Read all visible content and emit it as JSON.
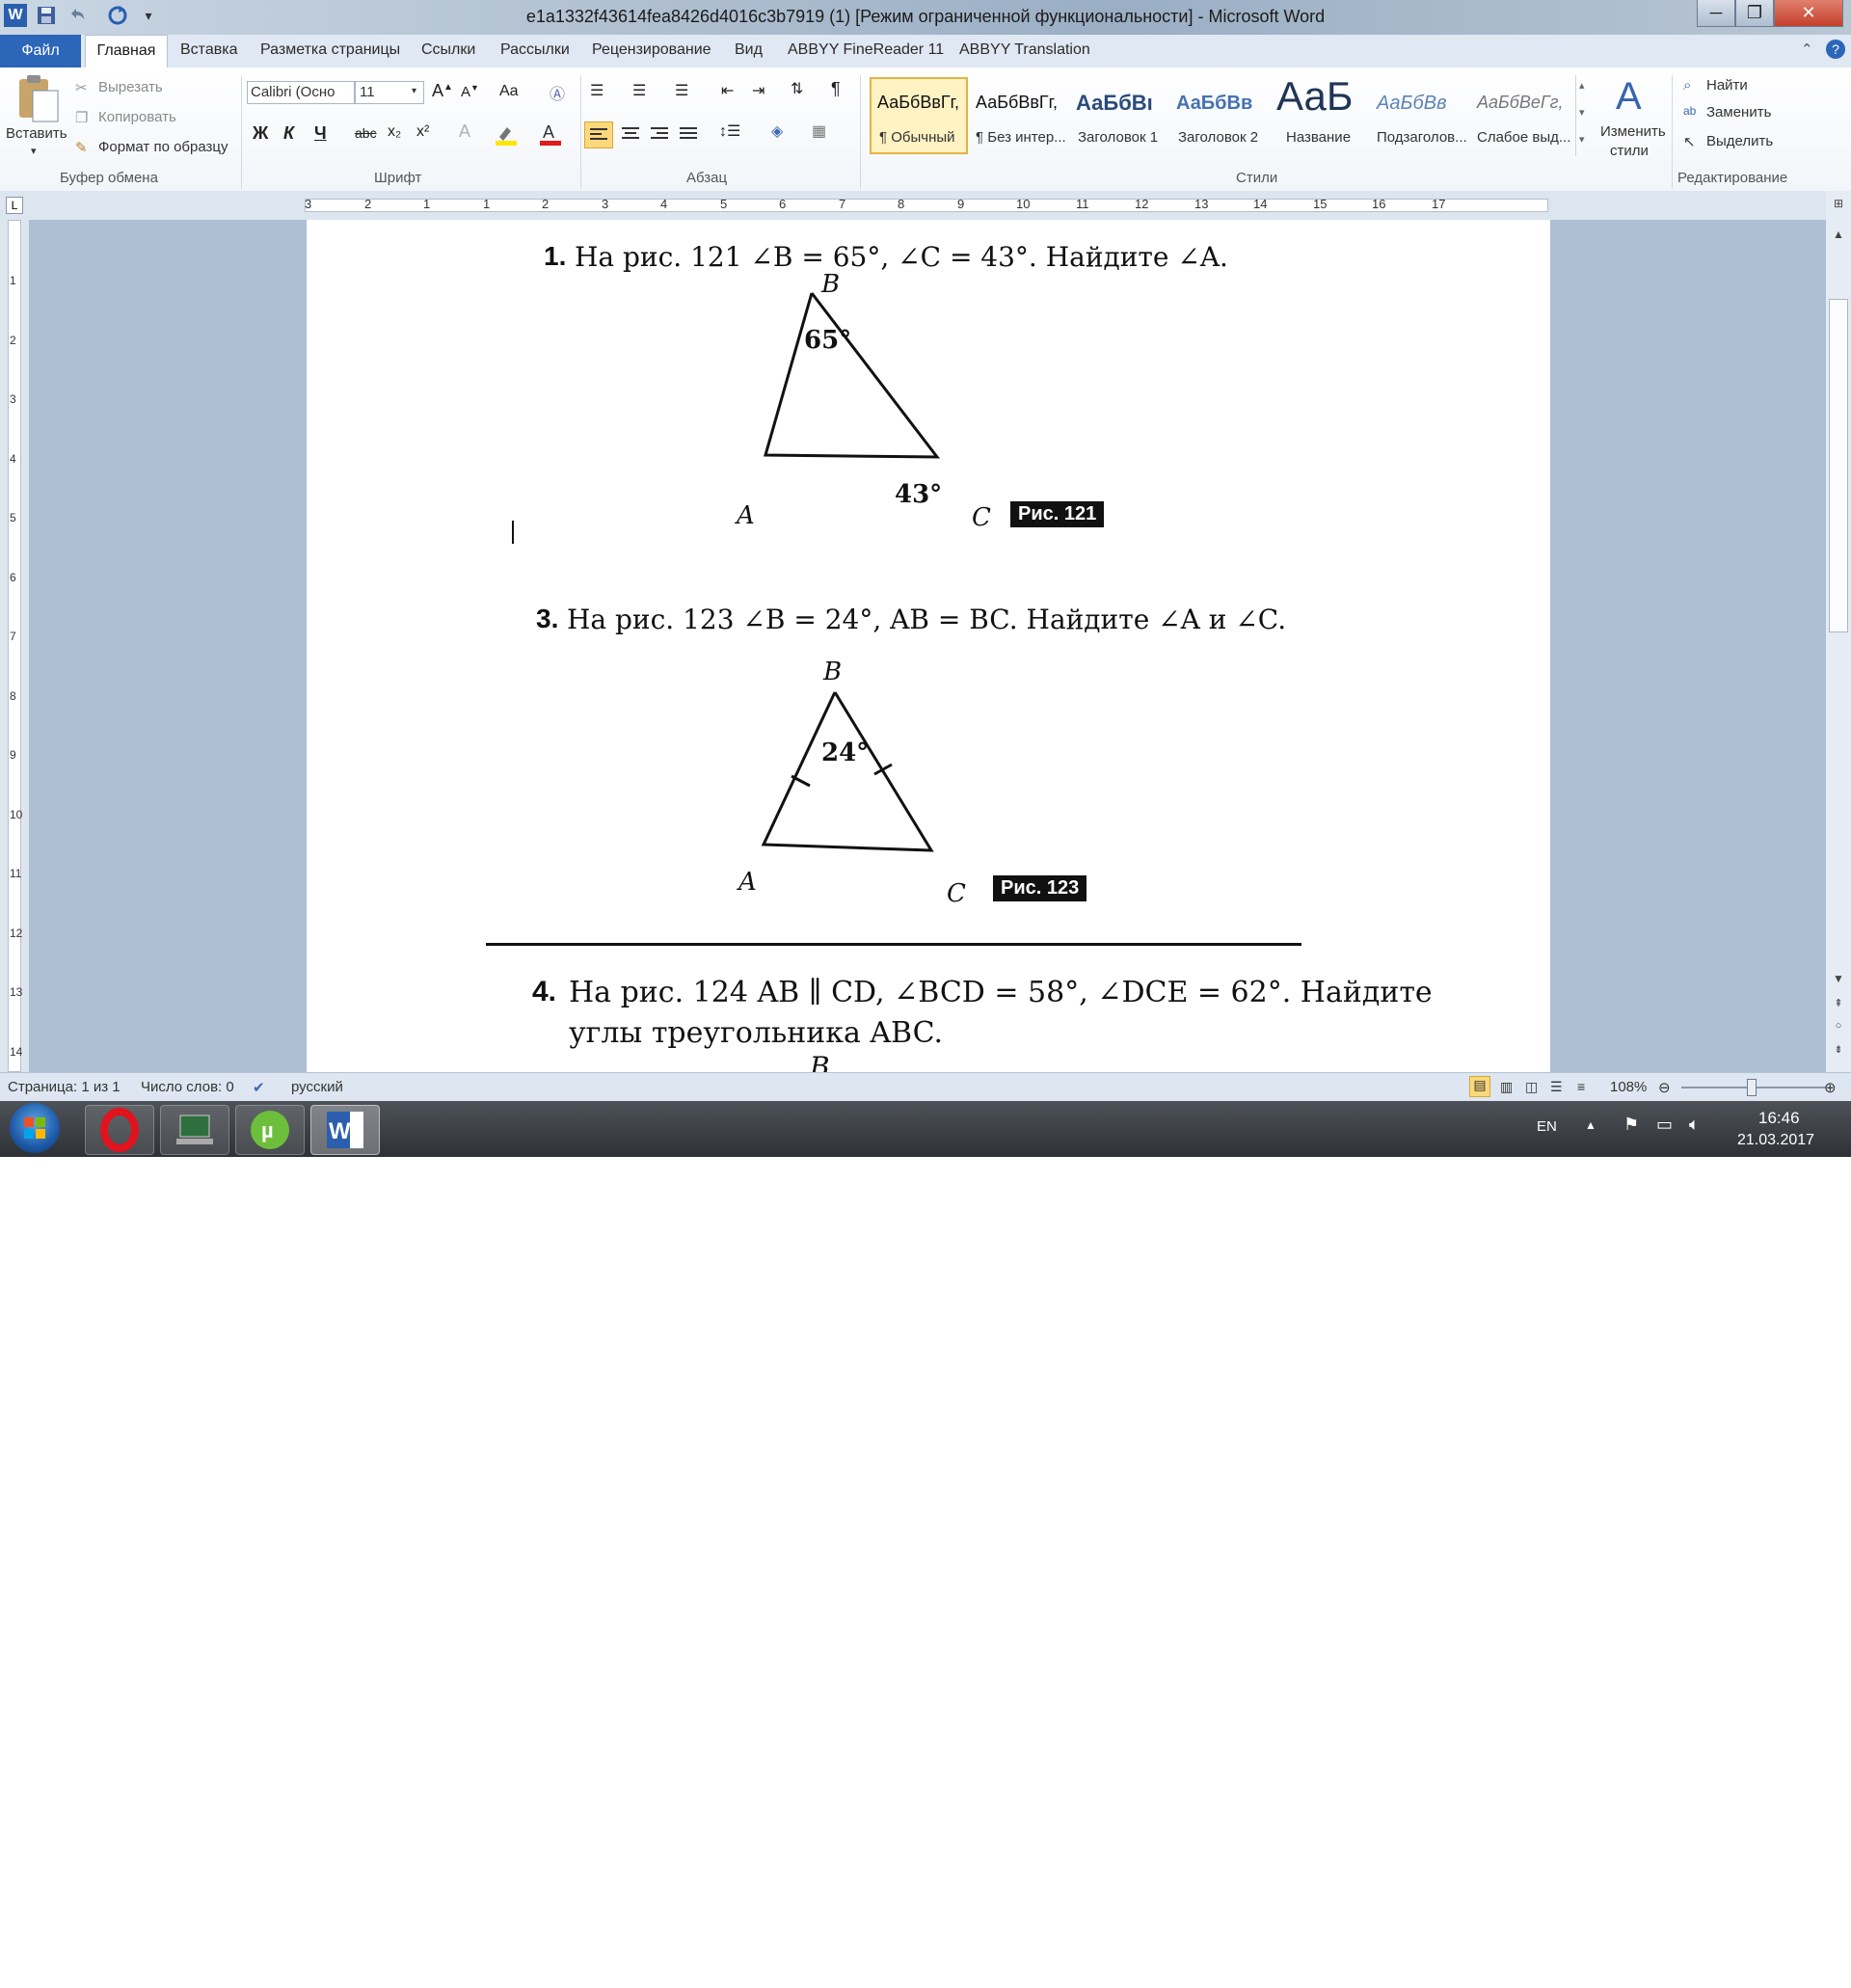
{
  "window": {
    "title": "e1a1332f43614fea8426d4016c3b7919 (1) [Режим ограниченной функциональности]  -  Microsoft Word",
    "minimize": "─",
    "maximize": "❐",
    "close": "✕"
  },
  "tabs": {
    "file": "Файл",
    "items": [
      "Главная",
      "Вставка",
      "Разметка страницы",
      "Ссылки",
      "Рассылки",
      "Рецензирование",
      "Вид",
      "ABBYY FineReader 11",
      "ABBYY Translation"
    ]
  },
  "clipboard": {
    "paste": "Вставить",
    "cut": "Вырезать",
    "copy": "Копировать",
    "format_painter": "Формат по образцу",
    "group": "Буфер обмена"
  },
  "font": {
    "name": "Calibri (Осно",
    "size": "11",
    "bold": "Ж",
    "italic": "К",
    "underline": "Ч",
    "strike": "abc",
    "sub": "x₂",
    "sup": "x²",
    "case": "Aa",
    "group": "Шрифт"
  },
  "paragraph": {
    "pilcrow": "¶",
    "group": "Абзац"
  },
  "styles": {
    "items": [
      {
        "preview": "АаБбВвГг,",
        "name": "¶ Обычный"
      },
      {
        "preview": "АаБбВвГг,",
        "name": "¶ Без интер..."
      },
      {
        "preview": "АаБбВı",
        "name": "Заголовок 1"
      },
      {
        "preview": "АаБбВв",
        "name": "Заголовок 2"
      },
      {
        "preview": "АаБ",
        "name": "Название"
      },
      {
        "preview": "АаБбВв",
        "name": "Подзаголов..."
      },
      {
        "preview": "АаБбВеГг,",
        "name": "Слабое выд..."
      }
    ],
    "change": "Изменить",
    "change2": "стили",
    "group": "Стили"
  },
  "editing": {
    "find": "Найти",
    "replace": "Заменить",
    "select": "Выделить",
    "group": "Редактирование"
  },
  "ruler_numbers": [
    "3",
    "2",
    "1",
    "1",
    "2",
    "3",
    "4",
    "5",
    "6",
    "7",
    "8",
    "9",
    "10",
    "11",
    "12",
    "13",
    "14",
    "15",
    "16",
    "17"
  ],
  "vruler_numbers": [
    "1",
    "2",
    "3",
    "4",
    "5",
    "6",
    "7",
    "8",
    "9",
    "10",
    "11",
    "12",
    "13",
    "14"
  ],
  "document": {
    "q1": {
      "num": "1.",
      "text": "На рис. 121 ∠B = 65°, ∠C = 43°. Найдите ∠A."
    },
    "fig121": {
      "label": "Рис. 121",
      "A": "A",
      "B": "B",
      "C": "C",
      "angleB": "65°",
      "angleC": "43°"
    },
    "q3": {
      "num": "3.",
      "text": "На рис. 123 ∠B = 24°, AB = BC. Найдите ∠A и ∠C."
    },
    "fig123": {
      "label": "Рис. 123",
      "A": "A",
      "B": "B",
      "C": "C",
      "angleB": "24°"
    },
    "q4": {
      "num": "4.",
      "line1": "На рис. 124 AB ∥ CD, ∠BCD = 58°, ∠DCE = 62°. Найдите",
      "line2": "углы треугольника ABC.",
      "B": "B"
    }
  },
  "status": {
    "page": "Страница: 1 из 1",
    "words": "Число слов: 0",
    "lang": "русский",
    "zoom": "108%"
  },
  "taskbar": {
    "lang": "EN",
    "time": "16:46",
    "date": "21.03.2017"
  },
  "colors": {
    "accent": "#2b66b8",
    "title_bg": "#b4c3d3",
    "selected_style": "#fbd97a"
  }
}
